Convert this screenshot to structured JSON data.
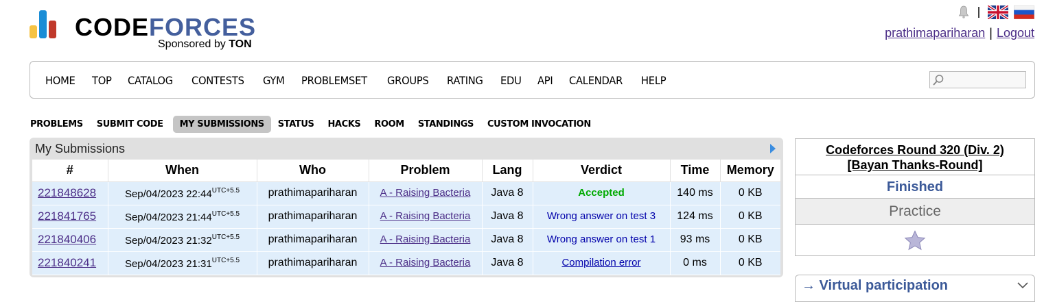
{
  "brand": {
    "name_part1": "CODE",
    "name_part2": "FORCES",
    "sponsor_prefix": "Sponsored by ",
    "sponsor_name": "TON",
    "bar_colors": [
      "#f6c343",
      "#1a8dd6",
      "#c0392b"
    ]
  },
  "header": {
    "username": "prathimapariharan",
    "separator": "|",
    "logout": "Logout"
  },
  "main_menu": [
    "HOME",
    "TOP",
    "CATALOG",
    "CONTESTS",
    "GYM",
    "PROBLEMSET",
    "GROUPS",
    "RATING",
    "EDU",
    "API",
    "CALENDAR",
    "HELP"
  ],
  "search": {
    "placeholder": ""
  },
  "second_menu": {
    "problems": "PROBLEMS",
    "submit": "SUBMIT CODE",
    "my_submissions": "MY SUBMISSIONS",
    "status": "STATUS",
    "hacks": "HACKS",
    "room": "ROOM",
    "standings": "STANDINGS",
    "custom": "CUSTOM INVOCATION"
  },
  "submissions": {
    "title": "My Submissions",
    "columns": [
      "#",
      "When",
      "Who",
      "Problem",
      "Lang",
      "Verdict",
      "Time",
      "Memory"
    ],
    "rows": [
      {
        "id": "221848628",
        "date": "Sep/04/2023 22:44",
        "tz": "UTC+5.5",
        "who": "prathimapariharan",
        "problem": "A - Raising Bacteria",
        "lang": "Java 8",
        "verdict": "Accepted",
        "time": "140 ms",
        "memory": "0 KB"
      },
      {
        "id": "221841765",
        "date": "Sep/04/2023 21:44",
        "tz": "UTC+5.5",
        "who": "prathimapariharan",
        "problem": "A - Raising Bacteria",
        "lang": "Java 8",
        "verdict": "Wrong answer on test 3",
        "time": "124 ms",
        "memory": "0 KB"
      },
      {
        "id": "221840406",
        "date": "Sep/04/2023 21:32",
        "tz": "UTC+5.5",
        "who": "prathimapariharan",
        "problem": "A - Raising Bacteria",
        "lang": "Java 8",
        "verdict": "Wrong answer on test 1",
        "time": "93 ms",
        "memory": "0 KB"
      },
      {
        "id": "221840241",
        "date": "Sep/04/2023 21:31",
        "tz": "UTC+5.5",
        "who": "prathimapariharan",
        "problem": "A - Raising Bacteria",
        "lang": "Java 8",
        "verdict": "Compilation error",
        "time": "0 ms",
        "memory": "0 KB"
      }
    ]
  },
  "contest": {
    "name_line1": "Codeforces Round 320 (Div. 2)",
    "name_line2": "[Bayan Thanks-Round]",
    "status": "Finished",
    "phase": "Practice"
  },
  "virtual": {
    "title": "→ Virtual participation"
  }
}
